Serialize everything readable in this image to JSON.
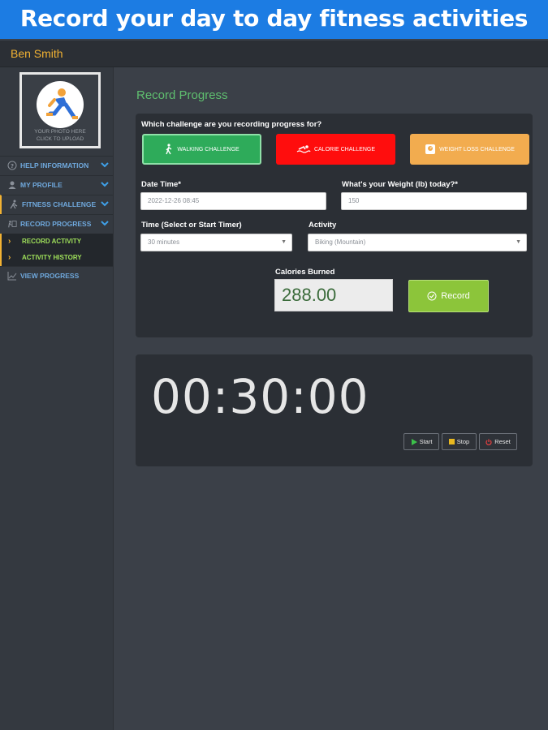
{
  "banner": {
    "title": "Record your day to day fitness activities"
  },
  "header": {
    "username": "Ben Smith"
  },
  "sidebar": {
    "photo_hint_line1": "YOUR PHOTO HERE",
    "photo_hint_line2": "CLICK TO UPLOAD",
    "items": [
      {
        "label": "HELP INFORMATION",
        "icon": "help-circle-icon"
      },
      {
        "label": "MY PROFILE",
        "icon": "user-icon"
      },
      {
        "label": "FITNESS CHALLENGE",
        "icon": "runner-icon"
      },
      {
        "label": "RECORD PROGRESS",
        "icon": "record-icon"
      }
    ],
    "subitems": [
      {
        "label": "RECORD ACTIVITY"
      },
      {
        "label": "ACTIVITY HISTORY"
      }
    ],
    "view_progress": {
      "label": "VIEW PROGRESS",
      "icon": "chart-icon"
    }
  },
  "main": {
    "section_title": "Record Progress",
    "question": "Which challenge are you recording progress for?",
    "challenges": [
      {
        "label": "WALKING CHALLENGE",
        "icon": "walking-icon",
        "color": "#2eab5a"
      },
      {
        "label": "CALORIE CHALLENGE",
        "icon": "swimming-icon",
        "color": "#ff0d0d"
      },
      {
        "label": "WEIGHT LOSS CHALLENGE",
        "icon": "scale-icon",
        "color": "#f2ac4f"
      }
    ],
    "date_time": {
      "label": "Date Time*",
      "value": "2022-12-26 08:45"
    },
    "weight": {
      "label": "What's your Weight (lb) today?*",
      "value": "150"
    },
    "time": {
      "label": "Time (Select or Start Timer)",
      "value": "30 minutes"
    },
    "activity": {
      "label": "Activity",
      "value": "Biking (Mountain)"
    },
    "calories": {
      "label": "Calories Burned",
      "value": "288.00"
    },
    "record_button": "Record"
  },
  "timer": {
    "display": "00:30:00",
    "start_label": "Start",
    "stop_label": "Stop",
    "reset_label": "Reset"
  },
  "colors": {
    "banner": "#1c7ce3",
    "accent": "#f2b233",
    "record": "#8cc53a"
  }
}
